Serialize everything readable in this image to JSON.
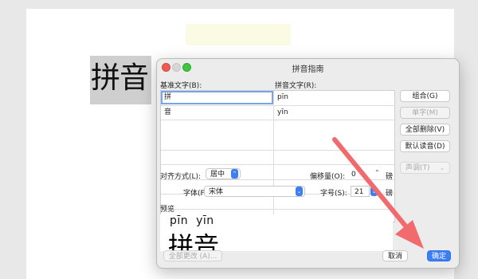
{
  "document": {
    "text": "拼音"
  },
  "dialog": {
    "title": "拼音指南",
    "base_text_label": "基准文字(B):",
    "ruby_text_label": "拼音文字(R):",
    "rows": [
      {
        "base": "拼",
        "ruby": "pīn"
      },
      {
        "base": "音",
        "ruby": "yīn"
      }
    ],
    "side_buttons": {
      "group": "组合(G)",
      "single": "单字(M)",
      "clear_all": "全部删除(V)",
      "default": "默认读音(D)"
    },
    "tone": {
      "label": "声调(T)"
    },
    "alignment": {
      "label": "对齐方式(L):",
      "value": "居中"
    },
    "offset": {
      "label": "偏移量(O):",
      "value": "0",
      "unit": "磅"
    },
    "font": {
      "label": "字体(F):",
      "value": "宋体"
    },
    "font_size": {
      "label": "字号(S):",
      "value": "21",
      "unit": "磅"
    },
    "preview": {
      "label": "预览",
      "pinyin": "pīn  yīn",
      "hanzi": "拼音"
    },
    "buttons": {
      "change_all": "全部更改 (A)...",
      "cancel": "取消",
      "ok": "确定"
    }
  },
  "colors": {
    "accent": "#3e7ef5",
    "arrow": "#f06a6e"
  }
}
